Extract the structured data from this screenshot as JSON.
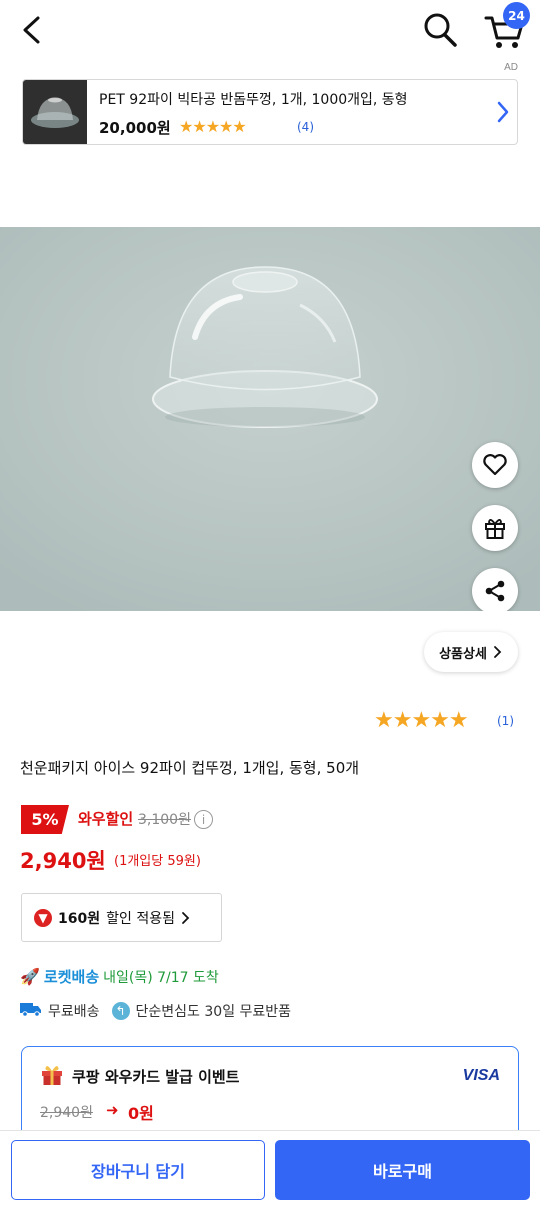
{
  "header": {
    "cart_count": "24",
    "icons": [
      "back-arrow-icon",
      "search-icon",
      "cart-icon"
    ]
  },
  "ad": {
    "label": "AD",
    "title": "PET 92파이 빅타공 반돔뚜껑, 1개, 1000개입, 동형",
    "price": "20,000원",
    "stars": "★★★★★",
    "review_count": "(4)"
  },
  "hero": {
    "actions": [
      "heart-icon",
      "gift-icon",
      "share-icon"
    ]
  },
  "detail_button": {
    "label": "상품상세"
  },
  "rating": {
    "stars": "★★★★★",
    "count": "(1)"
  },
  "product": {
    "title": "천운패키지 아이스 92파이 컵뚜껑, 1개입, 동형, 50개",
    "discount_percent": "5%",
    "wow_label": "와우할인",
    "original_price": "3,100원",
    "sale_price": "2,940원",
    "unit_price": "(1개입당 59원)"
  },
  "discount_applied": {
    "amount": "160원",
    "label": "할인 적용됨"
  },
  "delivery": {
    "rocket_label": "로켓배송",
    "rocket_date": "내일(목) 7/17 도착",
    "free_shipping": "무료배송",
    "free_return": "단순변심도 30일 무료반품"
  },
  "event": {
    "title": "쿠팡 와우카드 발급 이벤트",
    "brand": "VISA",
    "old_price": "2,940원",
    "arrow": "➜",
    "new_price": "0원"
  },
  "bottom": {
    "cart_button": "장바구니 담기",
    "buy_button": "바로구매"
  },
  "colors": {
    "accent": "#3466f5",
    "sale": "#dd1111",
    "star": "#f5a623",
    "rocket": "#1b8fd8",
    "arrival": "#1f9a3a"
  }
}
